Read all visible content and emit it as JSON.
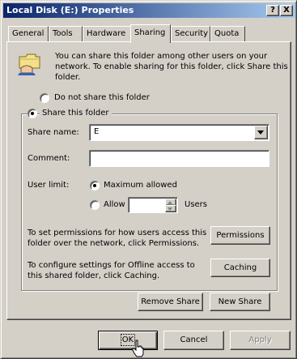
{
  "window": {
    "title": "Local Disk (E:) Properties",
    "help_glyph": "?",
    "close_glyph": "X"
  },
  "tabs": [
    "General",
    "Tools",
    "Hardware",
    "Sharing",
    "Security",
    "Quota"
  ],
  "sharing": {
    "info_text": [
      "You can share this folder among other users on your",
      "network. To enable sharing for this folder, click Share this",
      "folder."
    ],
    "do_not_share_label": "Do not share this folder",
    "share_label": "Share this folder",
    "share_name_label": "Share name:",
    "share_name_value": "E",
    "comment_label": "Comment:",
    "comment_value": "",
    "user_limit_label": "User limit:",
    "maximum_allowed_label": "Maximum allowed",
    "allow_label": "Allow",
    "allow_value": "",
    "users_label": "Users",
    "permissions_text": [
      "To set permissions for how users access this",
      "folder over the network, click Permissions."
    ],
    "permissions_button": "Permissions",
    "caching_text": [
      "To configure settings for Offline access to",
      "this shared folder, click Caching."
    ],
    "caching_button": "Caching",
    "remove_share_button": "Remove Share",
    "new_share_button": "New Share"
  },
  "footer": {
    "ok": "OK",
    "cancel": "Cancel",
    "apply": "Apply"
  }
}
